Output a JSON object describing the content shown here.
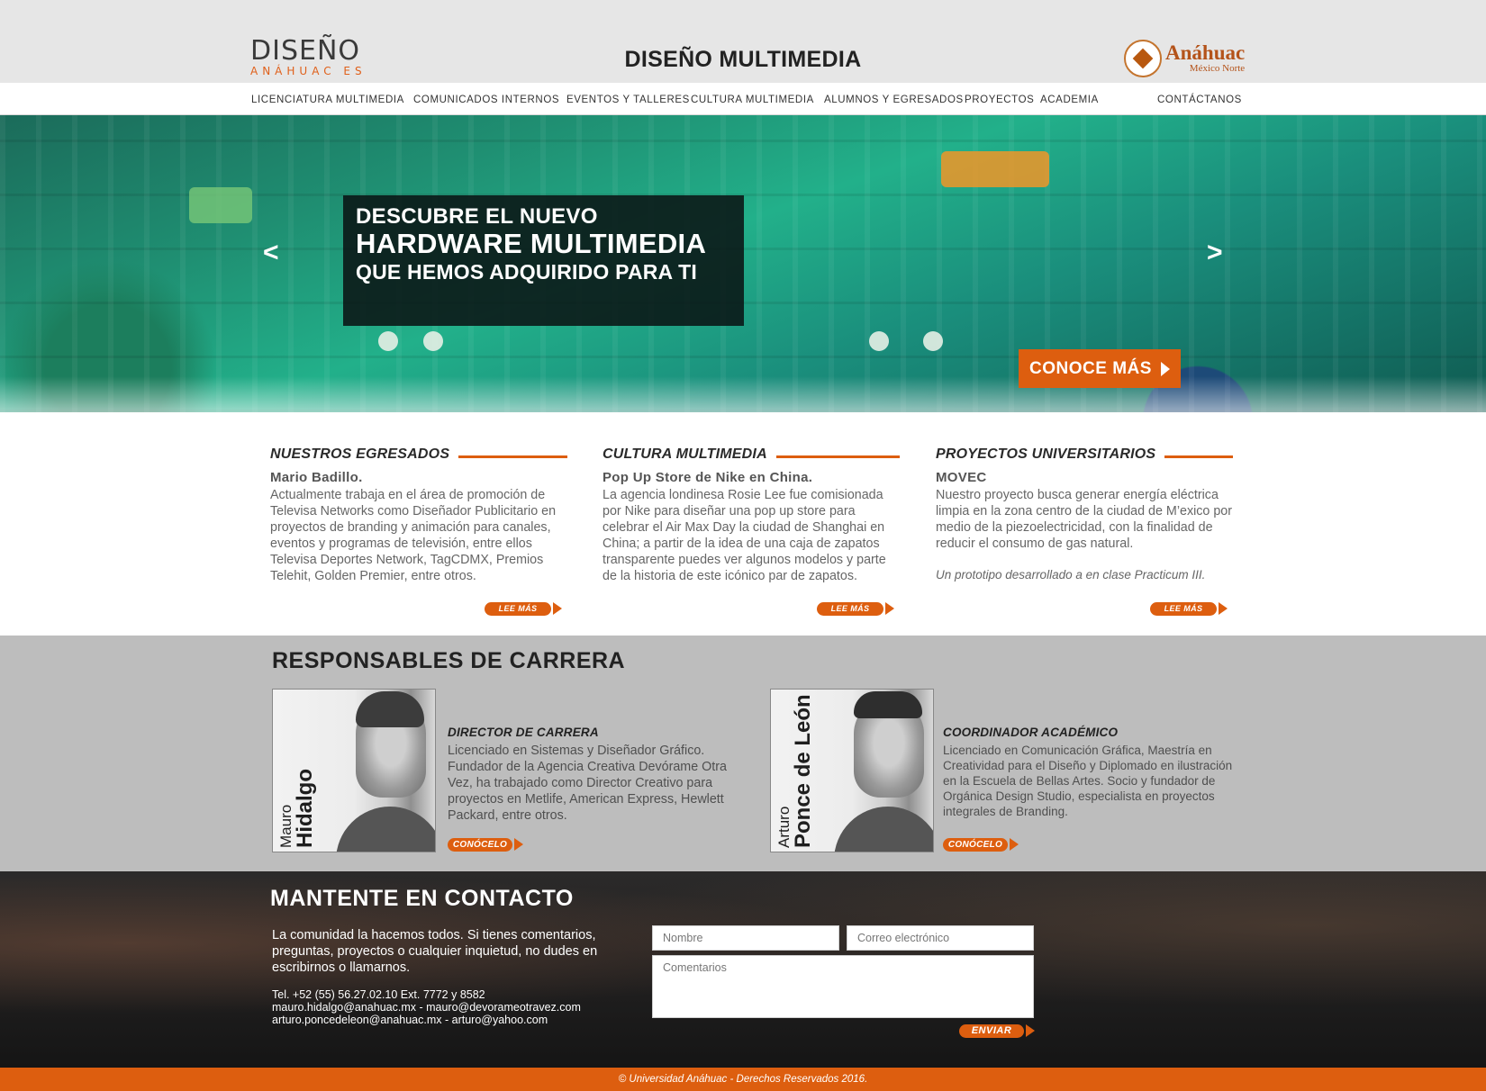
{
  "header": {
    "logo_word": "DISEÑO",
    "logo_sub": "ANÁHUAC ES",
    "title": "DISEÑO MULTIMEDIA",
    "partner_logo_name": "Anáhuac",
    "partner_logo_campus": "México Norte"
  },
  "nav": {
    "items": [
      "LICENCIATURA MULTIMEDIA",
      "COMUNICADOS INTERNOS",
      "EVENTOS Y TALLERES",
      "CULTURA MULTIMEDIA",
      "ALUMNOS Y EGRESADOS",
      "PROYECTOS",
      "ACADEMIA"
    ],
    "contact": "CONTÁCTANOS"
  },
  "hero": {
    "line1": "DESCUBRE  EL NUEVO",
    "line2": "HARDWARE MULTIMEDIA",
    "line3": "QUE HEMOS ADQUIRIDO PARA TI",
    "prev": "<",
    "next": ">",
    "cta": "CONOCE MÁS"
  },
  "columns": [
    {
      "title": "NUESTROS EGRESADOS",
      "subtitle": "Mario Badillo.",
      "body": "Actualmente trabaja en el área de promoción de Televisa Networks como Diseñador Publicitario en proyectos de branding y animación para canales, eventos y programas de televisión, entre ellos Televisa Deportes Network, TagCDMX, Premios Telehit, Golden Premier, entre otros.",
      "note": "",
      "more": "LEE MÁS"
    },
    {
      "title": "CULTURA MULTIMEDIA",
      "subtitle": "Pop Up Store de Nike en China.",
      "body": "La agencia londinesa Rosie Lee fue comisionada por Nike para diseñar una pop up store para celebrar el Air Max Day la ciudad de Shanghai en China; a partir de la idea de una caja de zapatos transparente puedes ver algunos modelos y parte de la historia de este icónico par de zapatos.",
      "note": "",
      "more": "LEE MÁS"
    },
    {
      "title": "PROYECTOS UNIVERSITARIOS",
      "subtitle": "MOVEC",
      "body": "Nuestro proyecto busca generar energía eléctrica limpia en la zona centro de la ciudad de M’exico por medio de la piezoelectricidad, con la finalidad de reducir el consumo de gas natural.",
      "note": "Un prototipo desarrollado a en clase Practicum III.",
      "more": "LEE MÁS"
    }
  ],
  "responsables": {
    "heading": "RESPONSABLES DE CARRERA",
    "people": [
      {
        "first": "Mauro",
        "last": "Hidalgo",
        "role": "DIRECTOR DE CARRERA",
        "desc": "Licenciado en Sistemas y Diseñador Gráfico. Fundador de la Agencia Creativa Devórame Otra Vez, ha trabajado como Director Creativo para proyectos en Metlife, American Express, Hewlett Packard, entre otros.",
        "button": "CONÓCELO"
      },
      {
        "first": "Arturo",
        "last": "Ponce de León",
        "role": "COORDINADOR ACADÉMICO",
        "desc": "Licenciado en Comunicación Gráfica, Maestría en Creatividad para el Diseño y Diplomado en ilustración en la Escuela de Bellas Artes. Socio y fundador de Orgánica Design Studio, especialista en proyectos integrales de Branding.",
        "button": "CONÓCELO"
      }
    ]
  },
  "contacto": {
    "heading": "MANTENTE EN CONTACTO",
    "lead": "La comunidad la hacemos todos. Si tienes comentarios, preguntas, proyectos o cualquier inquietud, no dudes en escribirnos o llamarnos.",
    "phone": "Tel. +52 (55) 56.27.02.10 Ext. 7772 y 8582",
    "email1": "mauro.hidalgo@anahuac.mx - mauro@devorameotravez.com",
    "email2": "arturo.poncedeleon@anahuac.mx - arturo@yahoo.com",
    "name_placeholder": "Nombre",
    "email_placeholder": "Correo electrónico",
    "comments_placeholder": "Comentarios",
    "send": "ENVIAR"
  },
  "footer": {
    "text": "© Universidad Anáhuac  - Derechos Reservados 2016."
  },
  "colors": {
    "accent": "#dd5e0f",
    "header_band": "#e6e6e6",
    "responsables_bg": "#bdbdbd",
    "contact_bg": "#1f1e1e"
  }
}
